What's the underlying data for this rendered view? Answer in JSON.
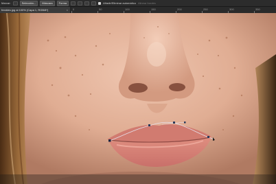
{
  "options_bar": {
    "mode_label": "Marcar:",
    "selection_button": "Selección...",
    "mask_button": "Máscara",
    "shape_button": "Forma",
    "auto_add_label": "Añadir/Eliminar automático",
    "align_edges_label": "Alinear bordes"
  },
  "document_tab": {
    "title": "freckles.jpg al 100% (Capa 1, RGB/8*)",
    "close_glyph": "×"
  },
  "ruler": {
    "labels": [
      "0",
      "50",
      "100",
      "150",
      "200",
      "250",
      "300",
      "350"
    ]
  },
  "photo": {
    "description_icon": "portrait-photo",
    "subject": "face-closeup",
    "path_anchor_color": "#2a3a5a",
    "path_line_color": "#d8d0d8"
  }
}
